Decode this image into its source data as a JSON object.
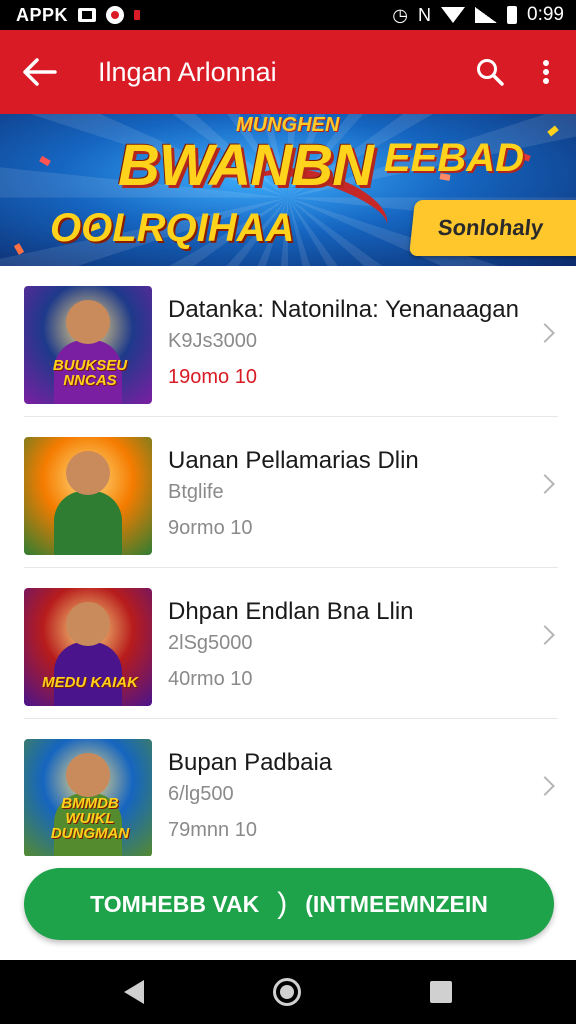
{
  "status_bar": {
    "app_label": "APPK",
    "time": "0:99",
    "network_letter": "N"
  },
  "app_bar": {
    "title": "Ilngan Arlonnai"
  },
  "banner": {
    "top_text": "MUNGHEN",
    "headline": "BWANBN",
    "side_text": "EEBAD",
    "subline": "OOLRQIHAA",
    "cta_label": "Sonlohaly"
  },
  "games": [
    {
      "title": "Datanka: Natonilna: Yenanaagan",
      "meta": "K9Js3000",
      "count": "19omo  10",
      "count_highlight": true,
      "thumb_text": "BUUKSEU NNCAS",
      "thumb_colors": [
        "#1e3a8a",
        "#7b1fa2"
      ]
    },
    {
      "title": "Uanan Pellamarias Dlin",
      "meta": "Btglife",
      "count": "9ormo  10",
      "count_highlight": false,
      "thumb_text": "",
      "thumb_colors": [
        "#f57c00",
        "#2e7d32"
      ]
    },
    {
      "title": "Dhpan Endlan Bna Llin",
      "meta": "2lSg5000",
      "count": "40rmo  10",
      "count_highlight": false,
      "thumb_text": "MEDU KAIAK",
      "thumb_colors": [
        "#b71c1c",
        "#4a148c"
      ]
    },
    {
      "title": "Bupan Padbaia",
      "meta": "6/lg500",
      "count": "79mnn  10",
      "count_highlight": false,
      "thumb_text": "BMMDB WUIKL DUNGMAN",
      "thumb_colors": [
        "#1565c0",
        "#558b2f"
      ]
    }
  ],
  "bottom_cta": {
    "left_label": "TOMHEBB VAK",
    "separator": ")",
    "right_label": "(INTMEEMNZEIN"
  },
  "colors": {
    "primary": "#d81b25",
    "cta_green": "#1fa34a",
    "banner_yellow": "#ffc72c"
  }
}
